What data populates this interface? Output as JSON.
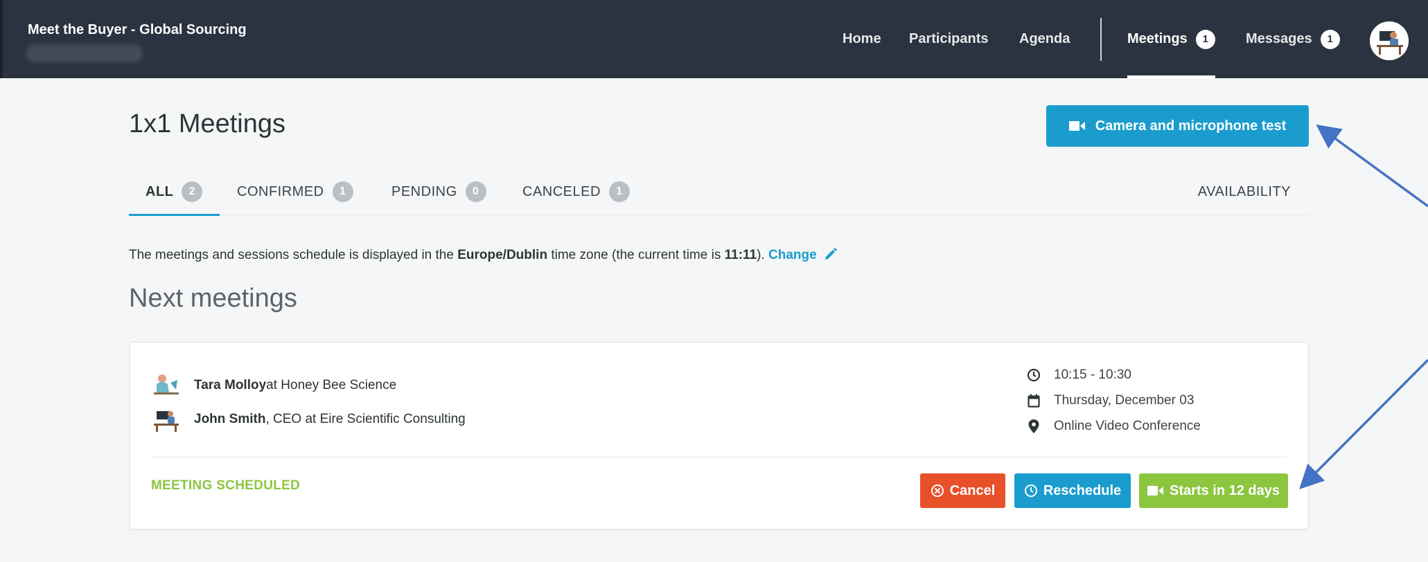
{
  "header": {
    "brand": "Meet the Buyer - Global Sourcing",
    "nav": {
      "home": "Home",
      "participants": "Participants",
      "agenda": "Agenda",
      "meetings": "Meetings",
      "meetings_badge": "1",
      "messages": "Messages",
      "messages_badge": "1"
    },
    "avatar_icon": "user-avatar-icon"
  },
  "page": {
    "title": "1x1 Meetings",
    "camera_button": "Camera and microphone test"
  },
  "tabs": [
    {
      "label": "ALL",
      "count": "2"
    },
    {
      "label": "CONFIRMED",
      "count": "1"
    },
    {
      "label": "PENDING",
      "count": "0"
    },
    {
      "label": "CANCELED",
      "count": "1"
    }
  ],
  "availability_tab": "AVAILABILITY",
  "timezone": {
    "prefix": "The meetings and sessions schedule is displayed in the ",
    "zone": "Europe/Dublin",
    "middle": " time zone (the current time is ",
    "time": "11:11",
    "suffix": "). ",
    "change": "Change"
  },
  "next_meetings": {
    "title": "Next meetings",
    "meeting": {
      "participants": [
        {
          "name": "Tara Molloy",
          "detail": " at Honey Bee Science"
        },
        {
          "name": "John Smith",
          "detail": ", CEO at Eire Scientific Consulting"
        }
      ],
      "time": "10:15 - 10:30",
      "date": "Thursday, December 03",
      "location": "Online Video Conference",
      "status": "MEETING SCHEDULED",
      "buttons": {
        "cancel": "Cancel",
        "reschedule": "Reschedule",
        "starts": "Starts in 12 days"
      }
    }
  },
  "colors": {
    "header_bg": "#2b3340",
    "accent_blue": "#1a9dce",
    "cancel_red": "#e8502a",
    "success_green": "#8cc63f",
    "annotation_arrow": "#4472c4"
  }
}
